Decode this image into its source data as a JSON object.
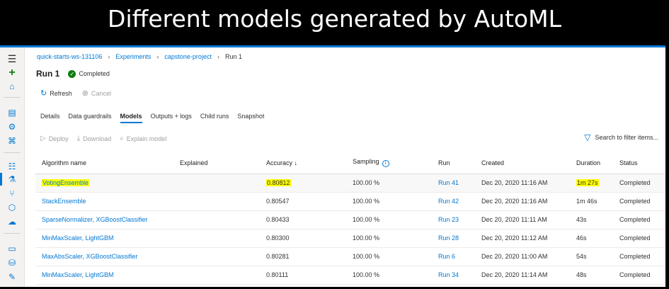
{
  "banner": {
    "title": "Different models generated by AutoML"
  },
  "breadcrumb": [
    "quick-starts-ws-131106",
    "Experiments",
    "capstone-project",
    "Run 1"
  ],
  "run": {
    "title": "Run 1",
    "status": "Completed"
  },
  "commands": {
    "refresh": "Refresh",
    "cancel": "Cancel"
  },
  "tabs": [
    "Details",
    "Data guardrails",
    "Models",
    "Outputs + logs",
    "Child runs",
    "Snapshot"
  ],
  "selected_tab": "Models",
  "toolbar": {
    "deploy": "Deploy",
    "download": "Download",
    "explain": "Explain model"
  },
  "filter": {
    "placeholder": "Search to filter items..."
  },
  "table": {
    "columns": [
      "Algorithm name",
      "Explained",
      "Accuracy ↓",
      "Sampling",
      "Run",
      "Created",
      "Duration",
      "Status"
    ],
    "rows": [
      {
        "algorithm": "VotingEnsemble",
        "explained": "",
        "accuracy": "0.80812",
        "sampling": "100.00 %",
        "run": "Run 41",
        "created": "Dec 20, 2020 11:16 AM",
        "duration": "1m 27s",
        "status": "Completed"
      },
      {
        "algorithm": "StackEnsemble",
        "explained": "",
        "accuracy": "0.80547",
        "sampling": "100.00 %",
        "run": "Run 42",
        "created": "Dec 20, 2020 11:16 AM",
        "duration": "1m 46s",
        "status": "Completed"
      },
      {
        "algorithm": "SparseNormalizer, XGBoostClassifier",
        "explained": "",
        "accuracy": "0.80433",
        "sampling": "100.00 %",
        "run": "Run 23",
        "created": "Dec 20, 2020 11:11 AM",
        "duration": "43s",
        "status": "Completed"
      },
      {
        "algorithm": "MinMaxScaler, LightGBM",
        "explained": "",
        "accuracy": "0.80300",
        "sampling": "100.00 %",
        "run": "Run 28",
        "created": "Dec 20, 2020 11:12 AM",
        "duration": "46s",
        "status": "Completed"
      },
      {
        "algorithm": "MaxAbsScaler, XGBoostClassifier",
        "explained": "",
        "accuracy": "0.80281",
        "sampling": "100.00 %",
        "run": "Run 6",
        "created": "Dec 20, 2020 11:00 AM",
        "duration": "54s",
        "status": "Completed"
      },
      {
        "algorithm": "MinMaxScaler, LightGBM",
        "explained": "",
        "accuracy": "0.80111",
        "sampling": "100.00 %",
        "run": "Run 34",
        "created": "Dec 20, 2020 11:14 AM",
        "duration": "48s",
        "status": "Completed"
      }
    ]
  },
  "colors": {
    "accent": "#0078d4",
    "success": "#107c10",
    "highlight": "#ffff00"
  },
  "icons": [
    "hamburger-menu-icon",
    "plus-icon",
    "home-icon",
    "notebook-icon",
    "automl-icon",
    "designer-icon",
    "datasets-icon",
    "experiments-icon",
    "pipelines-icon",
    "models-icon",
    "endpoints-icon",
    "compute-icon",
    "datastores-icon",
    "labeling-icon",
    "refresh-icon",
    "cancel-icon",
    "deploy-icon",
    "download-icon",
    "explain-icon",
    "filter-icon",
    "info-icon",
    "check-circle-icon"
  ]
}
